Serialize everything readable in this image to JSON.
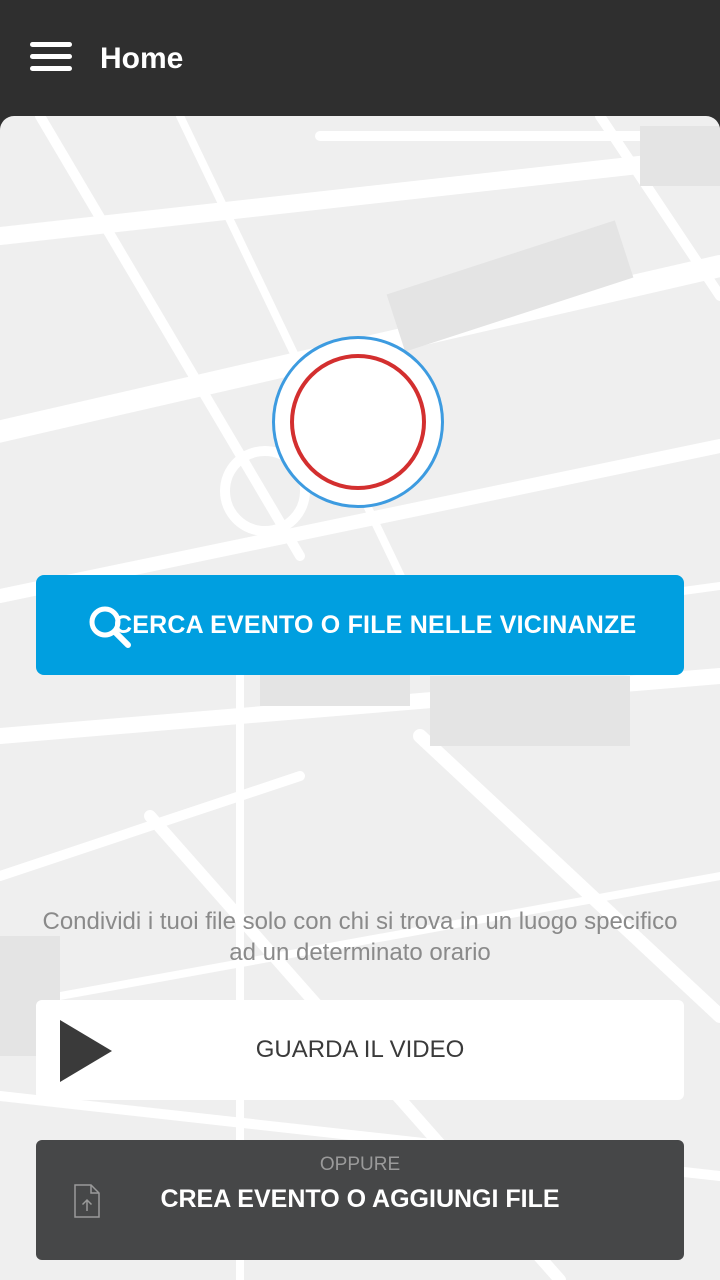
{
  "header": {
    "title": "Home",
    "menu_icon": "hamburger-menu-icon"
  },
  "main": {
    "record_button_icon": "record-icon",
    "search_button": {
      "label": "CERCA EVENTO O FILE NELLE VICINANZE",
      "icon": "search-icon"
    },
    "description": "Condividi i tuoi file solo con chi si trova in un luogo specifico ad un determinato orario",
    "video_button": {
      "label": "GUARDA IL VIDEO",
      "icon": "play-icon"
    },
    "create_button": {
      "sub_label": "OPPURE",
      "label": "CREA EVENTO O AGGIUNGI FILE",
      "icon": "file-upload-icon"
    }
  },
  "colors": {
    "topbar": "#2f2f2f",
    "accent_blue": "#009fe0",
    "record_ring_blue": "#3d9be0",
    "record_ring_red": "#d32f2f",
    "create_button_bg": "#464748"
  }
}
